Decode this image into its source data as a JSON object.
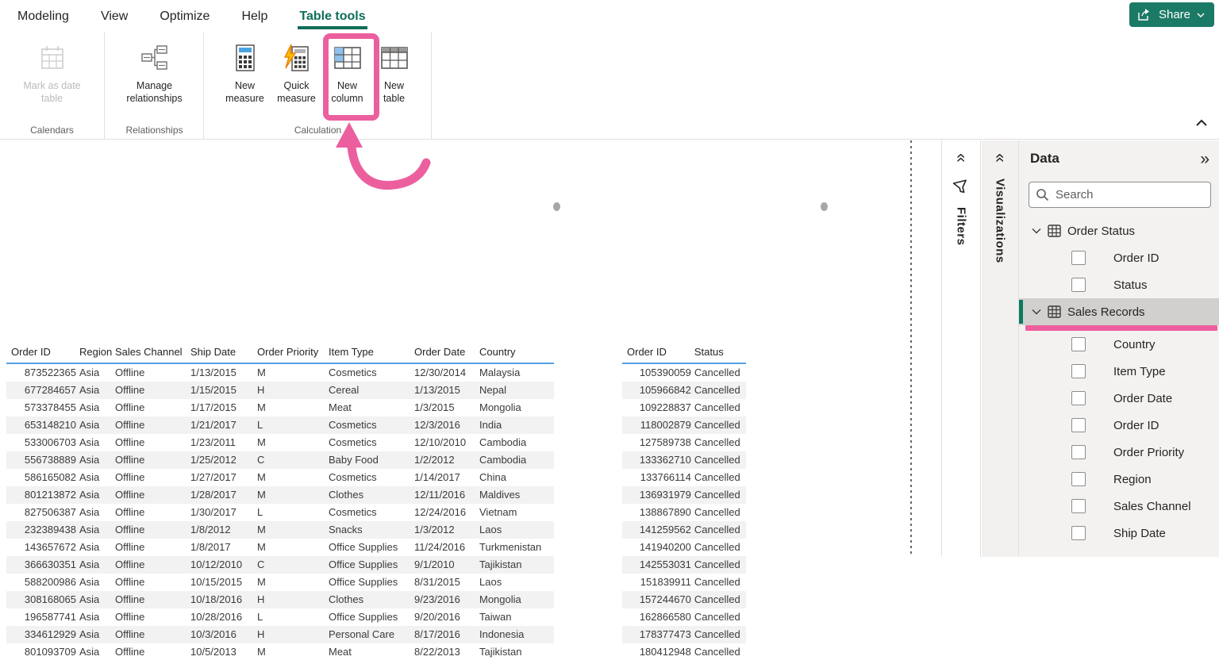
{
  "menu": {
    "tabs": [
      {
        "label": "Modeling"
      },
      {
        "label": "View"
      },
      {
        "label": "Optimize"
      },
      {
        "label": "Help"
      },
      {
        "label": "Table tools",
        "active": true
      }
    ]
  },
  "share": {
    "label": "Share"
  },
  "ribbon": {
    "groups": [
      {
        "label": "Calendars",
        "buttons": [
          {
            "label": "Mark as date table",
            "icon": "calendar-table-icon",
            "disabled": true
          }
        ]
      },
      {
        "label": "Relationships",
        "buttons": [
          {
            "label": "Manage relationships",
            "icon": "relationships-icon"
          }
        ]
      },
      {
        "label": "Calculation",
        "buttons": [
          {
            "label": "New measure",
            "icon": "new-measure-icon"
          },
          {
            "label": "Quick measure",
            "icon": "quick-measure-icon"
          },
          {
            "label": "New column",
            "icon": "new-column-icon",
            "highlighted": true
          },
          {
            "label": "New table",
            "icon": "new-table-icon"
          }
        ]
      }
    ]
  },
  "canvas": {
    "sales_table": {
      "columns": [
        "Order ID",
        "Region",
        "Sales Channel",
        "Ship Date",
        "Order Priority",
        "Item Type",
        "Order Date",
        "Country"
      ],
      "rows": [
        [
          "873522365",
          "Asia",
          "Offline",
          "1/13/2015",
          "M",
          "Cosmetics",
          "12/30/2014",
          "Malaysia"
        ],
        [
          "677284657",
          "Asia",
          "Offline",
          "1/15/2015",
          "H",
          "Cereal",
          "1/13/2015",
          "Nepal"
        ],
        [
          "573378455",
          "Asia",
          "Offline",
          "1/17/2015",
          "M",
          "Meat",
          "1/3/2015",
          "Mongolia"
        ],
        [
          "653148210",
          "Asia",
          "Offline",
          "1/21/2017",
          "L",
          "Cosmetics",
          "12/3/2016",
          "India"
        ],
        [
          "533006703",
          "Asia",
          "Offline",
          "1/23/2011",
          "M",
          "Cosmetics",
          "12/10/2010",
          "Cambodia"
        ],
        [
          "556738889",
          "Asia",
          "Offline",
          "1/25/2012",
          "C",
          "Baby Food",
          "1/2/2012",
          "Cambodia"
        ],
        [
          "586165082",
          "Asia",
          "Offline",
          "1/27/2017",
          "M",
          "Cosmetics",
          "1/14/2017",
          "China"
        ],
        [
          "801213872",
          "Asia",
          "Offline",
          "1/28/2017",
          "M",
          "Clothes",
          "12/11/2016",
          "Maldives"
        ],
        [
          "827506387",
          "Asia",
          "Offline",
          "1/30/2017",
          "L",
          "Cosmetics",
          "12/24/2016",
          "Vietnam"
        ],
        [
          "232389438",
          "Asia",
          "Offline",
          "1/8/2012",
          "M",
          "Snacks",
          "1/3/2012",
          "Laos"
        ],
        [
          "143657672",
          "Asia",
          "Offline",
          "1/8/2017",
          "M",
          "Office Supplies",
          "11/24/2016",
          "Turkmenistan"
        ],
        [
          "366630351",
          "Asia",
          "Offline",
          "10/12/2010",
          "C",
          "Office Supplies",
          "9/1/2010",
          "Tajikistan"
        ],
        [
          "588200986",
          "Asia",
          "Offline",
          "10/15/2015",
          "M",
          "Office Supplies",
          "8/31/2015",
          "Laos"
        ],
        [
          "308168065",
          "Asia",
          "Offline",
          "10/18/2016",
          "H",
          "Clothes",
          "9/23/2016",
          "Mongolia"
        ],
        [
          "196587741",
          "Asia",
          "Offline",
          "10/28/2016",
          "L",
          "Office Supplies",
          "9/20/2016",
          "Taiwan"
        ],
        [
          "334612929",
          "Asia",
          "Offline",
          "10/3/2016",
          "H",
          "Personal Care",
          "8/17/2016",
          "Indonesia"
        ],
        [
          "801093709",
          "Asia",
          "Offline",
          "10/5/2013",
          "M",
          "Meat",
          "8/22/2013",
          "Tajikistan"
        ]
      ]
    },
    "status_table": {
      "columns": [
        "Order ID",
        "Status"
      ],
      "rows": [
        [
          "105390059",
          "Cancelled"
        ],
        [
          "105966842",
          "Cancelled"
        ],
        [
          "109228837",
          "Cancelled"
        ],
        [
          "118002879",
          "Cancelled"
        ],
        [
          "127589738",
          "Cancelled"
        ],
        [
          "133362710",
          "Cancelled"
        ],
        [
          "133766114",
          "Cancelled"
        ],
        [
          "136931979",
          "Cancelled"
        ],
        [
          "138867890",
          "Cancelled"
        ],
        [
          "141259562",
          "Cancelled"
        ],
        [
          "141940200",
          "Cancelled"
        ],
        [
          "142553031",
          "Cancelled"
        ],
        [
          "151839911",
          "Cancelled"
        ],
        [
          "157244670",
          "Cancelled"
        ],
        [
          "162866580",
          "Cancelled"
        ],
        [
          "178377473",
          "Cancelled"
        ],
        [
          "180412948",
          "Cancelled"
        ]
      ]
    }
  },
  "panes": {
    "filters": {
      "label": "Filters"
    },
    "visualizations": {
      "label": "Visualizations"
    },
    "data": {
      "title": "Data",
      "search_placeholder": "Search",
      "tables": [
        {
          "name": "Order Status",
          "selected": false,
          "annotated": false,
          "fields": [
            "Order ID",
            "Status"
          ]
        },
        {
          "name": "Sales Records",
          "selected": true,
          "annotated": true,
          "fields": [
            "Country",
            "Item Type",
            "Order Date",
            "Order ID",
            "Order Priority",
            "Region",
            "Sales Channel",
            "Ship Date"
          ]
        }
      ]
    }
  },
  "colors": {
    "accent_teal": "#0e6e59",
    "selection_bar_teal": "#0a7a5f",
    "accent_pink": "#ec5f9e",
    "table_header_underline_blue": "#54a1e4",
    "share_button_green": "#1b7a66"
  }
}
